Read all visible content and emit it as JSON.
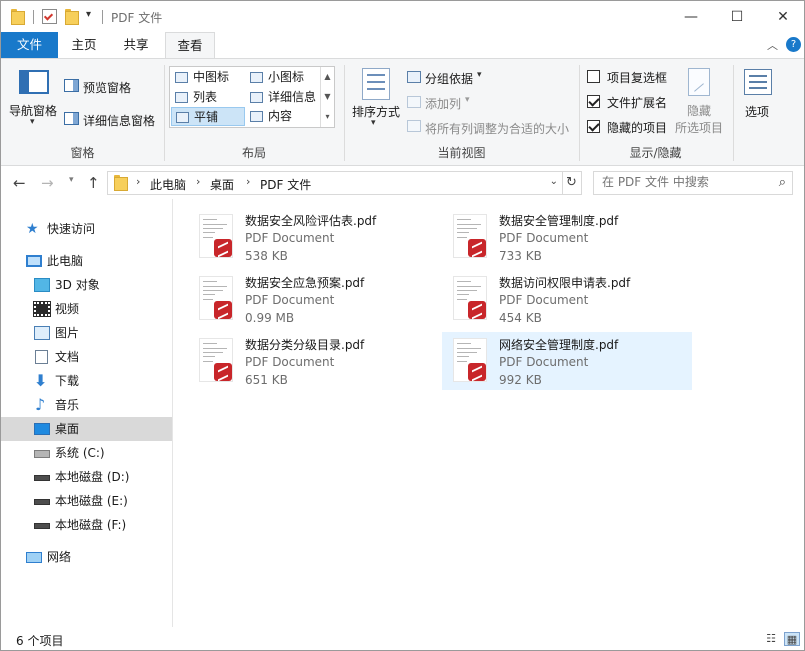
{
  "window": {
    "title": "PDF 文件",
    "controls": {
      "minimize": "—",
      "maximize": "☐",
      "close": "✕"
    }
  },
  "ribbon": {
    "tabs": [
      {
        "label": "文件",
        "active": false
      },
      {
        "label": "主页",
        "active": false
      },
      {
        "label": "共享",
        "active": false
      },
      {
        "label": "查看",
        "active": true
      }
    ],
    "panes": {
      "nav_pane": "导航窗格",
      "preview_pane": "预览窗格",
      "details_pane": "详细信息窗格",
      "group_label": "窗格"
    },
    "layout": {
      "items": [
        "中图标",
        "小图标",
        "列表",
        "详细信息",
        "平铺",
        "内容"
      ],
      "selected": "平铺",
      "group_label": "布局"
    },
    "current_view": {
      "sort_by": "排序方式",
      "group_by": "分组依据",
      "add_columns": "添加列",
      "size_all_columns": "将所有列调整为合适的大小",
      "group_label": "当前视图"
    },
    "show_hide": {
      "item_checkboxes": {
        "label": "项目复选框",
        "checked": false
      },
      "file_extensions": {
        "label": "文件扩展名",
        "checked": true
      },
      "hidden_items": {
        "label": "隐藏的项目",
        "checked": true
      },
      "hide_selected_line1": "隐藏",
      "hide_selected_line2": "所选项目",
      "group_label": "显示/隐藏"
    },
    "options": "选项"
  },
  "address": {
    "crumbs": [
      "此电脑",
      "桌面",
      "PDF 文件"
    ],
    "search_placeholder": "在 PDF 文件 中搜索"
  },
  "nav": {
    "items": [
      {
        "label": "快速访问",
        "icon": "star-icon"
      },
      {
        "label": "此电脑",
        "icon": "computer-icon"
      },
      {
        "label": "3D 对象",
        "icon": "cube-icon"
      },
      {
        "label": "视频",
        "icon": "video-icon"
      },
      {
        "label": "图片",
        "icon": "picture-icon"
      },
      {
        "label": "文档",
        "icon": "document-icon"
      },
      {
        "label": "下载",
        "icon": "download-icon"
      },
      {
        "label": "音乐",
        "icon": "music-icon"
      },
      {
        "label": "桌面",
        "icon": "desktop-icon",
        "selected": true
      },
      {
        "label": "系统 (C:)",
        "icon": "drive-icon"
      },
      {
        "label": "本地磁盘 (D:)",
        "icon": "drive-icon"
      },
      {
        "label": "本地磁盘 (E:)",
        "icon": "drive-icon"
      },
      {
        "label": "本地磁盘 (F:)",
        "icon": "drive-icon"
      },
      {
        "label": "网络",
        "icon": "network-icon"
      }
    ]
  },
  "files": [
    {
      "name": "数据安全风险评估表.pdf",
      "type": "PDF Document",
      "size": "538 KB"
    },
    {
      "name": "数据安全管理制度.pdf",
      "type": "PDF Document",
      "size": "733 KB"
    },
    {
      "name": "数据安全应急预案.pdf",
      "type": "PDF Document",
      "size": "0.99 MB"
    },
    {
      "name": "数据访问权限申请表.pdf",
      "type": "PDF Document",
      "size": "454 KB"
    },
    {
      "name": "数据分类分级目录.pdf",
      "type": "PDF Document",
      "size": "651 KB"
    },
    {
      "name": "网络安全管理制度.pdf",
      "type": "PDF Document",
      "size": "992 KB",
      "highlighted": true
    }
  ],
  "status": {
    "count": "6 个项目"
  },
  "colors": {
    "accent": "#1979ca",
    "selection": "#cce4f7",
    "hover": "#e5f3ff",
    "pdf_badge": "#c8262a"
  }
}
